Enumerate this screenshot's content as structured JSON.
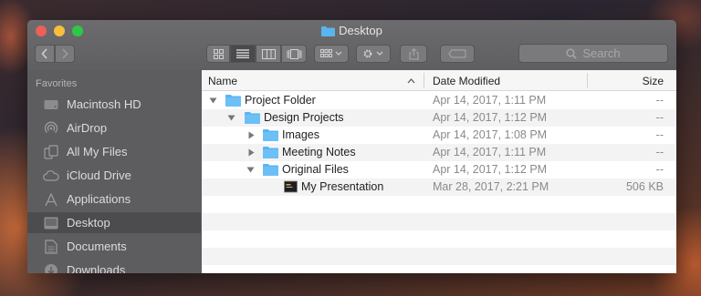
{
  "window": {
    "title": "Desktop"
  },
  "toolbar": {
    "search_placeholder": "Search"
  },
  "sidebar": {
    "header": "Favorites",
    "items": [
      {
        "label": "Macintosh HD",
        "icon": "hard-drive-icon"
      },
      {
        "label": "AirDrop",
        "icon": "airdrop-icon"
      },
      {
        "label": "All My Files",
        "icon": "all-files-icon"
      },
      {
        "label": "iCloud Drive",
        "icon": "cloud-icon"
      },
      {
        "label": "Applications",
        "icon": "applications-icon"
      },
      {
        "label": "Desktop",
        "icon": "desktop-icon",
        "selected": true
      },
      {
        "label": "Documents",
        "icon": "documents-icon"
      },
      {
        "label": "Downloads",
        "icon": "downloads-icon"
      }
    ]
  },
  "columns": {
    "name": "Name",
    "date": "Date Modified",
    "size": "Size"
  },
  "rows": [
    {
      "name": "Project Folder",
      "date": "Apr 14, 2017, 1:11 PM",
      "size": "--",
      "expanded": true,
      "type": "folder"
    },
    {
      "name": "Design Projects",
      "date": "Apr 14, 2017, 1:12 PM",
      "size": "--",
      "expanded": true,
      "type": "folder"
    },
    {
      "name": "Images",
      "date": "Apr 14, 2017, 1:08 PM",
      "size": "--",
      "expanded": false,
      "type": "folder"
    },
    {
      "name": "Meeting Notes",
      "date": "Apr 14, 2017, 1:11 PM",
      "size": "--",
      "expanded": false,
      "type": "folder"
    },
    {
      "name": "Original Files",
      "date": "Apr 14, 2017, 1:12 PM",
      "size": "--",
      "expanded": true,
      "type": "folder"
    },
    {
      "name": "My Presentation",
      "date": "Mar 28, 2017, 2:21 PM",
      "size": "506 KB",
      "type": "file"
    }
  ],
  "colors": {
    "folder": "#5ab4f0",
    "sidebar_bg": "#5d5d60",
    "selected": "#4c4c4e"
  }
}
